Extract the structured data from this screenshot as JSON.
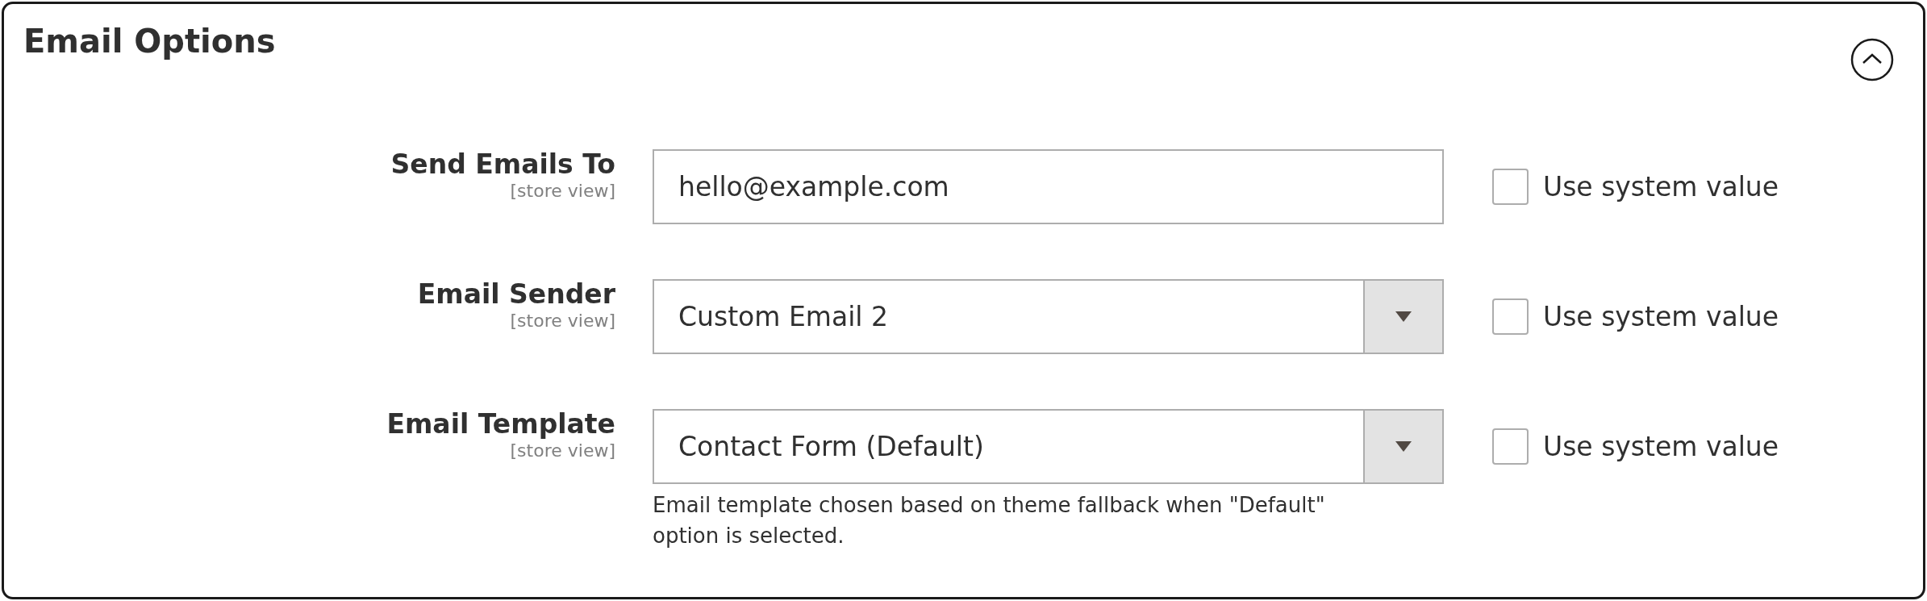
{
  "section": {
    "title": "Email Options",
    "expanded": true
  },
  "fields": [
    {
      "kind": "text",
      "label": "Send Emails To",
      "scope": "[store view]",
      "value": "hello@example.com",
      "use_system_value": false,
      "checkbox_label": "Use system value"
    },
    {
      "kind": "select",
      "label": "Email Sender",
      "scope": "[store view]",
      "value": "Custom Email 2",
      "use_system_value": false,
      "checkbox_label": "Use system value"
    },
    {
      "kind": "select",
      "label": "Email Template",
      "scope": "[store view]",
      "value": "Contact Form (Default)",
      "use_system_value": false,
      "checkbox_label": "Use system value",
      "note": "Email template chosen based on theme fallback when \"Default\" option is selected."
    }
  ]
}
